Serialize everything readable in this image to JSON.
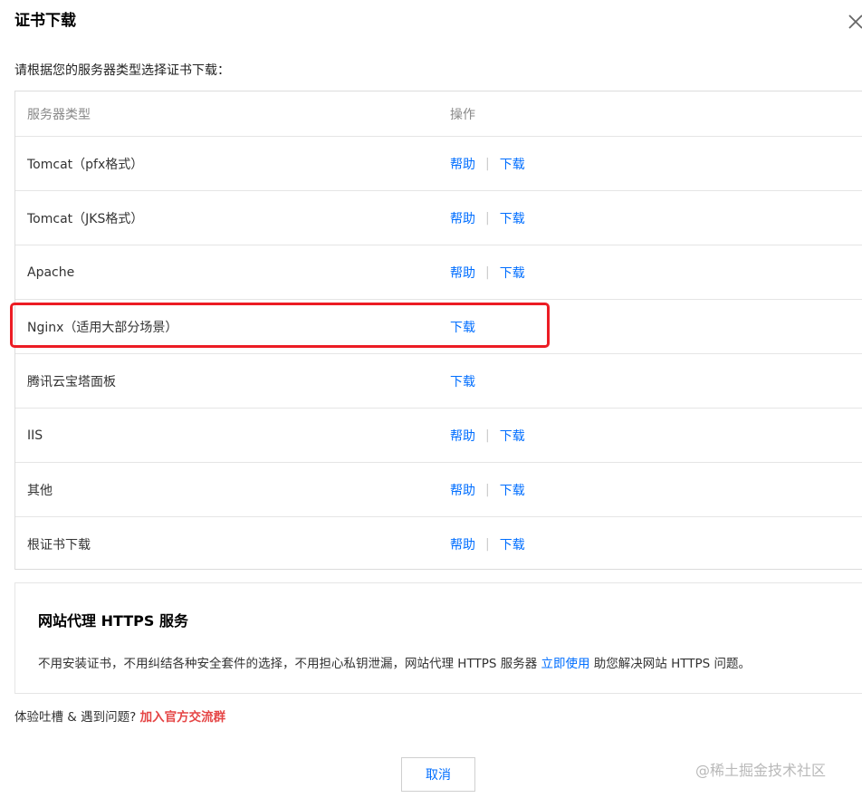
{
  "dialog": {
    "title": "证书下载",
    "intro": "请根据您的服务器类型选择证书下载："
  },
  "table": {
    "headers": {
      "type": "服务器类型",
      "ops": "操作"
    },
    "rows": [
      {
        "type": "Tomcat（pfx格式）",
        "help": "帮助",
        "sep": "|",
        "download": "下载"
      },
      {
        "type": "Tomcat（JKS格式）",
        "help": "帮助",
        "sep": "|",
        "download": "下载"
      },
      {
        "type": "Apache",
        "help": "帮助",
        "sep": "|",
        "download": "下载"
      },
      {
        "type": "Nginx（适用大部分场景）",
        "download": "下载",
        "highlighted": true
      },
      {
        "type": "腾讯云宝塔面板",
        "download": "下载"
      },
      {
        "type": "IIS",
        "help": "帮助",
        "sep": "|",
        "download": "下载"
      },
      {
        "type": "其他",
        "help": "帮助",
        "sep": "|",
        "download": "下载"
      },
      {
        "type": "根证书下载",
        "help": "帮助",
        "sep": "|",
        "download": "下载"
      }
    ]
  },
  "promo": {
    "title": "网站代理 HTTPS 服务",
    "text_before": "不用安装证书，不用纠结各种安全套件的选择，不用担心私钥泄漏，网站代理 HTTPS 服务器 ",
    "link": "立即使用",
    "text_after": " 助您解决网站 HTTPS 问题。"
  },
  "feedback": {
    "text": "体验吐槽 & 遇到问题? ",
    "link": "加入官方交流群"
  },
  "footer": {
    "cancel_label": "取消",
    "watermark": "@稀土掘金技术社区"
  },
  "colors": {
    "link": "#006eff",
    "highlight_border": "#ec1c24",
    "feedback_link": "#e54545"
  },
  "icons": {
    "close": "close-icon"
  }
}
